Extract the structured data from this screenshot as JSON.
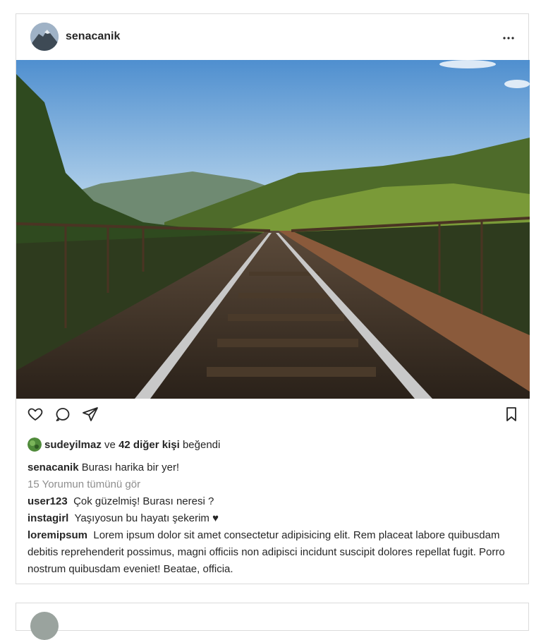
{
  "post": {
    "username": "senacanik",
    "liked_by_user": "sudeyilmaz",
    "likes_connector": "ve",
    "others_count_text": "42 diğer kişi",
    "likes_suffix": "beğendi",
    "caption": {
      "user": "senacanik",
      "text": "Burası harika bir yer!"
    },
    "view_all_comments": "15 Yorumun tümünü gör",
    "comments": [
      {
        "user": "user123",
        "text": "Çok güzelmiş! Burası neresi ?"
      },
      {
        "user": "instagirl",
        "text": "Yaşıyosun bu hayatı şekerim ♥"
      },
      {
        "user": "loremipsum",
        "text": "Lorem ipsum dolor sit amet consectetur adipisicing elit. Rem placeat labore quibusdam debitis reprehenderit possimus, magni officiis non adipisci incidunt suscipit dolores repellat fugit. Porro nostrum quibusdam eveniet! Beatae, officia."
      }
    ]
  },
  "icons": {
    "more": "more-options-icon",
    "like": "heart-icon",
    "comment": "comment-icon",
    "share": "send-icon",
    "save": "bookmark-icon"
  },
  "colors": {
    "border": "#dbdbdb",
    "text": "#262626",
    "muted": "#8e8e8e"
  }
}
